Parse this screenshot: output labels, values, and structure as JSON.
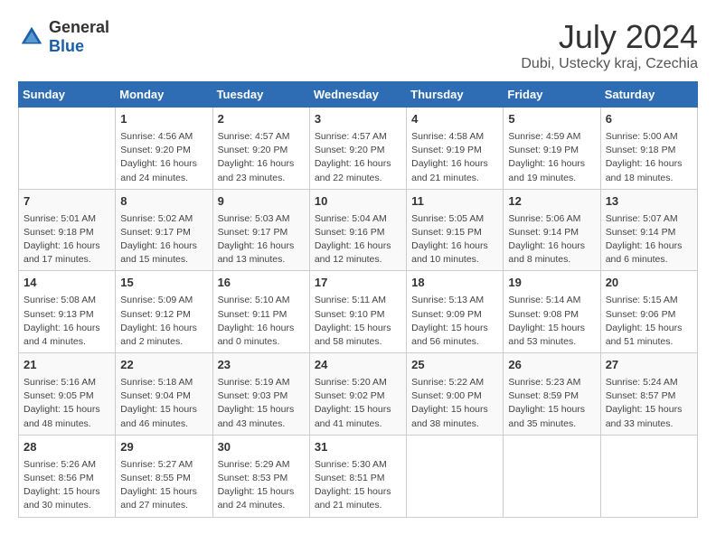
{
  "header": {
    "logo_general": "General",
    "logo_blue": "Blue",
    "title": "July 2024",
    "subtitle": "Dubi, Ustecky kraj, Czechia"
  },
  "days_of_week": [
    "Sunday",
    "Monday",
    "Tuesday",
    "Wednesday",
    "Thursday",
    "Friday",
    "Saturday"
  ],
  "weeks": [
    [
      {
        "day": "",
        "info": ""
      },
      {
        "day": "1",
        "info": "Sunrise: 4:56 AM\nSunset: 9:20 PM\nDaylight: 16 hours\nand 24 minutes."
      },
      {
        "day": "2",
        "info": "Sunrise: 4:57 AM\nSunset: 9:20 PM\nDaylight: 16 hours\nand 23 minutes."
      },
      {
        "day": "3",
        "info": "Sunrise: 4:57 AM\nSunset: 9:20 PM\nDaylight: 16 hours\nand 22 minutes."
      },
      {
        "day": "4",
        "info": "Sunrise: 4:58 AM\nSunset: 9:19 PM\nDaylight: 16 hours\nand 21 minutes."
      },
      {
        "day": "5",
        "info": "Sunrise: 4:59 AM\nSunset: 9:19 PM\nDaylight: 16 hours\nand 19 minutes."
      },
      {
        "day": "6",
        "info": "Sunrise: 5:00 AM\nSunset: 9:18 PM\nDaylight: 16 hours\nand 18 minutes."
      }
    ],
    [
      {
        "day": "7",
        "info": "Sunrise: 5:01 AM\nSunset: 9:18 PM\nDaylight: 16 hours\nand 17 minutes."
      },
      {
        "day": "8",
        "info": "Sunrise: 5:02 AM\nSunset: 9:17 PM\nDaylight: 16 hours\nand 15 minutes."
      },
      {
        "day": "9",
        "info": "Sunrise: 5:03 AM\nSunset: 9:17 PM\nDaylight: 16 hours\nand 13 minutes."
      },
      {
        "day": "10",
        "info": "Sunrise: 5:04 AM\nSunset: 9:16 PM\nDaylight: 16 hours\nand 12 minutes."
      },
      {
        "day": "11",
        "info": "Sunrise: 5:05 AM\nSunset: 9:15 PM\nDaylight: 16 hours\nand 10 minutes."
      },
      {
        "day": "12",
        "info": "Sunrise: 5:06 AM\nSunset: 9:14 PM\nDaylight: 16 hours\nand 8 minutes."
      },
      {
        "day": "13",
        "info": "Sunrise: 5:07 AM\nSunset: 9:14 PM\nDaylight: 16 hours\nand 6 minutes."
      }
    ],
    [
      {
        "day": "14",
        "info": "Sunrise: 5:08 AM\nSunset: 9:13 PM\nDaylight: 16 hours\nand 4 minutes."
      },
      {
        "day": "15",
        "info": "Sunrise: 5:09 AM\nSunset: 9:12 PM\nDaylight: 16 hours\nand 2 minutes."
      },
      {
        "day": "16",
        "info": "Sunrise: 5:10 AM\nSunset: 9:11 PM\nDaylight: 16 hours\nand 0 minutes."
      },
      {
        "day": "17",
        "info": "Sunrise: 5:11 AM\nSunset: 9:10 PM\nDaylight: 15 hours\nand 58 minutes."
      },
      {
        "day": "18",
        "info": "Sunrise: 5:13 AM\nSunset: 9:09 PM\nDaylight: 15 hours\nand 56 minutes."
      },
      {
        "day": "19",
        "info": "Sunrise: 5:14 AM\nSunset: 9:08 PM\nDaylight: 15 hours\nand 53 minutes."
      },
      {
        "day": "20",
        "info": "Sunrise: 5:15 AM\nSunset: 9:06 PM\nDaylight: 15 hours\nand 51 minutes."
      }
    ],
    [
      {
        "day": "21",
        "info": "Sunrise: 5:16 AM\nSunset: 9:05 PM\nDaylight: 15 hours\nand 48 minutes."
      },
      {
        "day": "22",
        "info": "Sunrise: 5:18 AM\nSunset: 9:04 PM\nDaylight: 15 hours\nand 46 minutes."
      },
      {
        "day": "23",
        "info": "Sunrise: 5:19 AM\nSunset: 9:03 PM\nDaylight: 15 hours\nand 43 minutes."
      },
      {
        "day": "24",
        "info": "Sunrise: 5:20 AM\nSunset: 9:02 PM\nDaylight: 15 hours\nand 41 minutes."
      },
      {
        "day": "25",
        "info": "Sunrise: 5:22 AM\nSunset: 9:00 PM\nDaylight: 15 hours\nand 38 minutes."
      },
      {
        "day": "26",
        "info": "Sunrise: 5:23 AM\nSunset: 8:59 PM\nDaylight: 15 hours\nand 35 minutes."
      },
      {
        "day": "27",
        "info": "Sunrise: 5:24 AM\nSunset: 8:57 PM\nDaylight: 15 hours\nand 33 minutes."
      }
    ],
    [
      {
        "day": "28",
        "info": "Sunrise: 5:26 AM\nSunset: 8:56 PM\nDaylight: 15 hours\nand 30 minutes."
      },
      {
        "day": "29",
        "info": "Sunrise: 5:27 AM\nSunset: 8:55 PM\nDaylight: 15 hours\nand 27 minutes."
      },
      {
        "day": "30",
        "info": "Sunrise: 5:29 AM\nSunset: 8:53 PM\nDaylight: 15 hours\nand 24 minutes."
      },
      {
        "day": "31",
        "info": "Sunrise: 5:30 AM\nSunset: 8:51 PM\nDaylight: 15 hours\nand 21 minutes."
      },
      {
        "day": "",
        "info": ""
      },
      {
        "day": "",
        "info": ""
      },
      {
        "day": "",
        "info": ""
      }
    ]
  ]
}
